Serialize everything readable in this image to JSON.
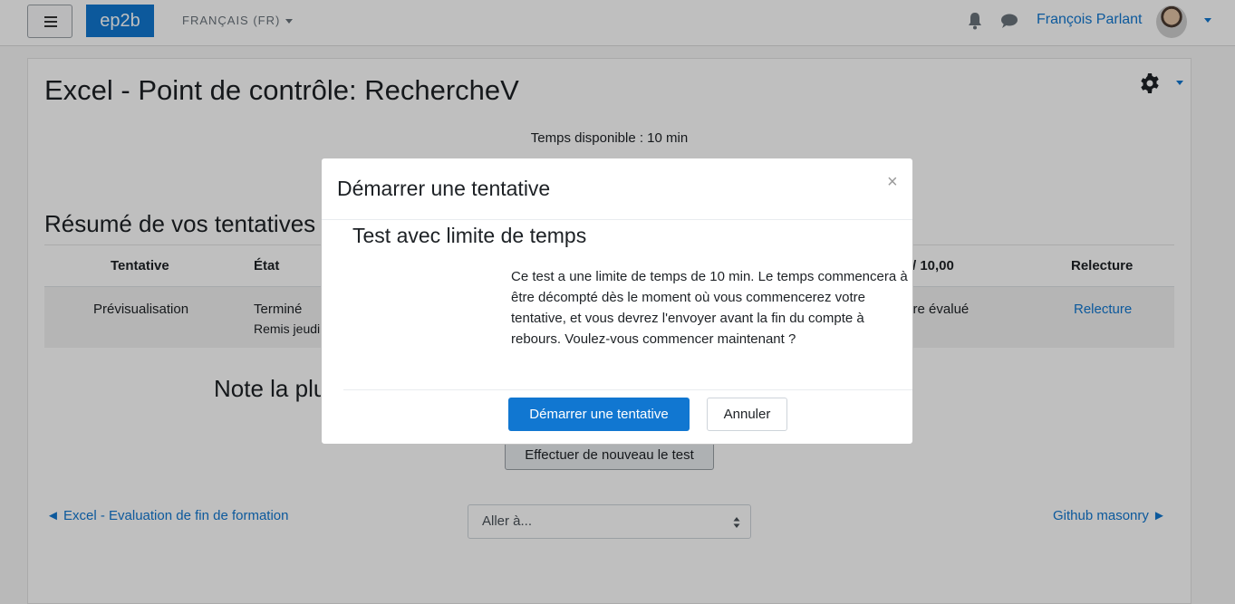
{
  "navbar": {
    "brand": "ep2b",
    "language": "FRANÇAIS (FR)",
    "user_name": "François Parlant"
  },
  "page": {
    "title": "Excel - Point de contrôle: RechercheV",
    "time_available": "Temps disponible : 10 min",
    "summary_title": "Résumé de vos tentatives",
    "table": {
      "headers": [
        "Tentative",
        "État",
        "/ 10,00",
        "Relecture"
      ],
      "row": {
        "attempt": "Prévisualisation",
        "state": "Terminé",
        "submitted": "Remis jeudi",
        "grade": "Pas encore évalué",
        "review_link": "Relecture"
      }
    },
    "best_grade": "Note la plus haute",
    "retry_button": "Effectuer de nouveau le test",
    "prev_link": "◄ Excel - Evaluation de fin de formation",
    "jump_select": "Aller à...",
    "next_link": "Github masonry ►"
  },
  "modal": {
    "title": "Démarrer une tentative",
    "close": "×",
    "subtitle": "Test avec limite de temps",
    "text": "Ce test a une limite de temps de 10 min. Le temps commencera à être décompté dès le moment où vous commencerez votre tentative, et vous devrez l'envoyer avant la fin du compte à rebours. Voulez-vous commencer maintenant ?",
    "start_button": "Démarrer une tentative",
    "cancel_button": "Annuler"
  },
  "colors": {
    "accent": "#1177d1",
    "overlay": "rgba(0,0,0,0.25)"
  }
}
